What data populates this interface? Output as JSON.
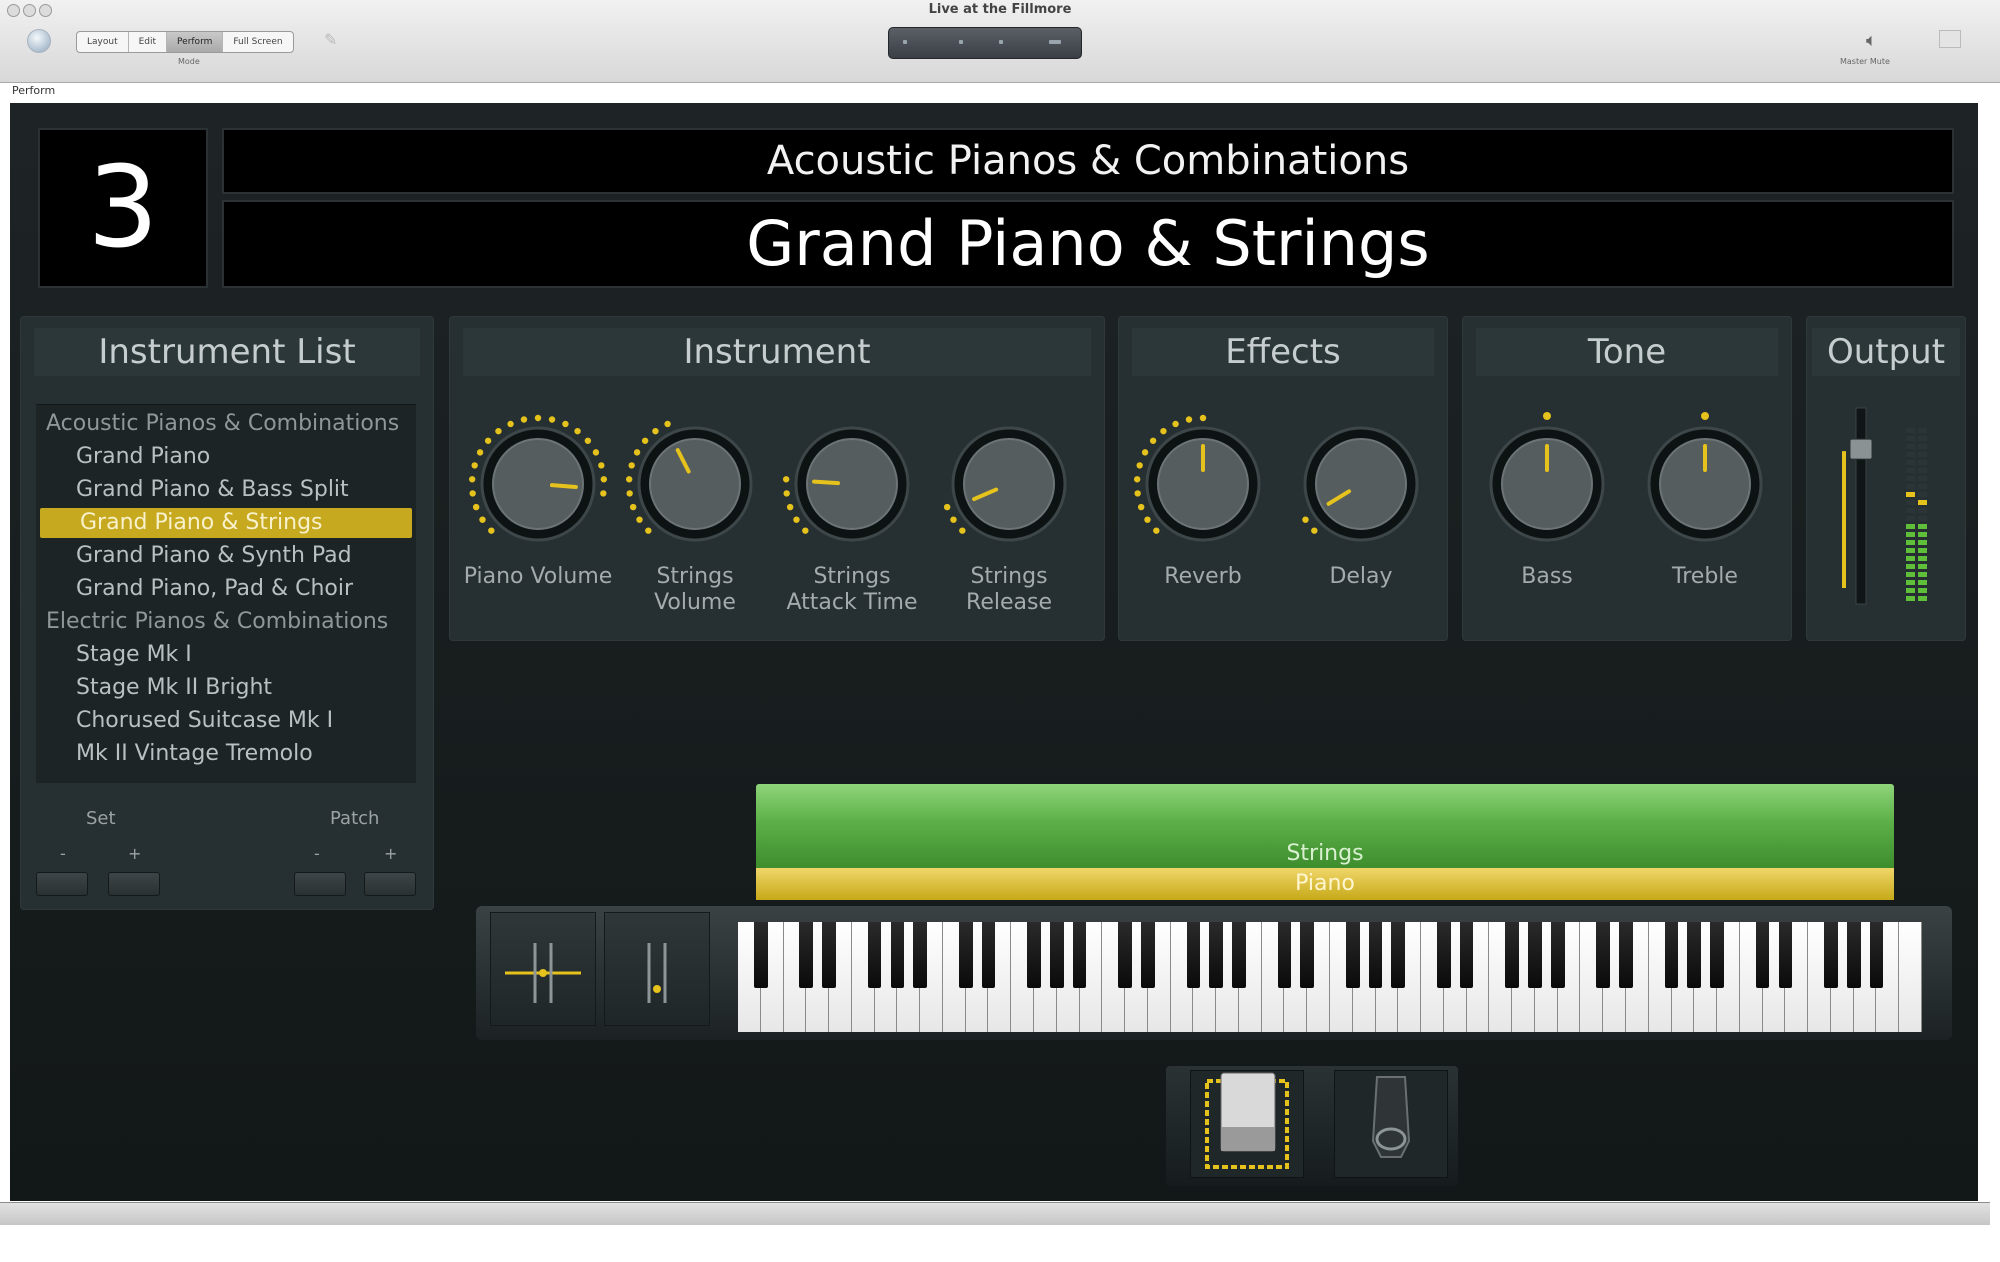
{
  "window": {
    "title": "Live at the Fillmore",
    "modes": [
      "Layout",
      "Edit",
      "Perform",
      "Full Screen"
    ],
    "active_mode": "Perform",
    "mode_label": "Mode",
    "current_screen": "Perform",
    "right_buttons": [
      "Master Mute"
    ]
  },
  "header": {
    "patch_number": "3",
    "bank_name": "Acoustic Pianos & Combinations",
    "patch_name": "Grand Piano & Strings"
  },
  "instrument_list": {
    "title": "Instrument List",
    "items": [
      {
        "label": "Acoustic Pianos & Combinations",
        "type": "category"
      },
      {
        "label": "Grand Piano",
        "type": "patch"
      },
      {
        "label": "Grand Piano & Bass Split",
        "type": "patch"
      },
      {
        "label": "Grand Piano & Strings",
        "type": "patch",
        "selected": true
      },
      {
        "label": "Grand Piano & Synth Pad",
        "type": "patch"
      },
      {
        "label": "Grand Piano, Pad & Choir",
        "type": "patch"
      },
      {
        "label": "Electric Pianos & Combinations",
        "type": "category"
      },
      {
        "label": "Stage Mk I",
        "type": "patch"
      },
      {
        "label": "Stage Mk II Bright",
        "type": "patch"
      },
      {
        "label": "Chorused Suitcase Mk I",
        "type": "patch"
      },
      {
        "label": "Mk II Vintage Tremolo",
        "type": "patch"
      }
    ],
    "set_label": "Set",
    "patch_label": "Patch",
    "minus": "-",
    "plus": "+"
  },
  "panels": {
    "instrument": {
      "title": "Instrument",
      "knobs": [
        {
          "label": "Piano Volume",
          "value": 0.85,
          "center": false
        },
        {
          "label": "Strings Volume",
          "value": 0.4,
          "center": false
        },
        {
          "label": "Strings Attack Time",
          "value": 0.18,
          "center": false
        },
        {
          "label": "Strings Release",
          "value": 0.08,
          "center": false
        }
      ]
    },
    "effects": {
      "title": "Effects",
      "knobs": [
        {
          "label": "Reverb",
          "value": 0.5,
          "center": false
        },
        {
          "label": "Delay",
          "value": 0.05,
          "center": false
        }
      ]
    },
    "tone": {
      "title": "Tone",
      "knobs": [
        {
          "label": "Bass",
          "value": 0.5,
          "center": true
        },
        {
          "label": "Treble",
          "value": 0.5,
          "center": true
        }
      ]
    },
    "output": {
      "title": "Output",
      "fader_level": 0.78
    }
  },
  "layers": {
    "strings": "Strings",
    "piano": "Piano"
  },
  "colors": {
    "accent": "#c7a91f",
    "knob_dot": "#e6c21d",
    "strings_layer": "#5cb048",
    "piano_layer": "#d8bb2a"
  }
}
